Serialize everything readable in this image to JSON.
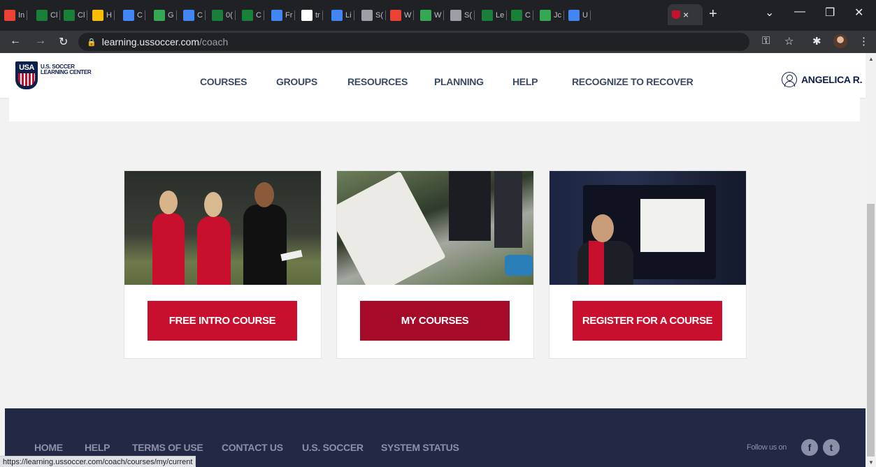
{
  "browser": {
    "tabs": [
      {
        "label": "In",
        "color": "#ea4335"
      },
      {
        "label": "Cl",
        "color": "#188038"
      },
      {
        "label": "Cl",
        "color": "#188038"
      },
      {
        "label": "H",
        "color": "#fbbc04"
      },
      {
        "label": "C",
        "color": "#4285f4"
      },
      {
        "label": "G",
        "color": "#34a853"
      },
      {
        "label": "C",
        "color": "#4285f4"
      },
      {
        "label": "0(",
        "color": "#188038"
      },
      {
        "label": "C",
        "color": "#188038"
      },
      {
        "label": "Fr",
        "color": "#4285f4"
      },
      {
        "label": "tr",
        "color": "#ffffff"
      },
      {
        "label": "Li",
        "color": "#4285f4"
      },
      {
        "label": "S(",
        "color": "#9aa0a6"
      },
      {
        "label": "W",
        "color": "#ea4335"
      },
      {
        "label": "W",
        "color": "#34a853"
      },
      {
        "label": "S(",
        "color": "#9aa0a6"
      },
      {
        "label": "Le",
        "color": "#188038"
      },
      {
        "label": "C",
        "color": "#188038"
      },
      {
        "label": "Jc",
        "color": "#34a853"
      },
      {
        "label": "U",
        "color": "#4285f4"
      }
    ],
    "active_tab_close": "×",
    "new_tab": "+",
    "url_host": "learning.ussoccer.com",
    "url_path": "/coach",
    "status_url": "https://learning.ussoccer.com/coach/courses/my/current"
  },
  "site": {
    "logo_crest": "USA",
    "logo_line1": "U.S. SOCCER",
    "logo_line2": "LEARNING CENTER",
    "nav": [
      "COURSES",
      "GROUPS",
      "RESOURCES",
      "PLANNING",
      "HELP",
      "RECOGNIZE TO RECOVER"
    ],
    "user_name": "ANGELICA R."
  },
  "cards": [
    {
      "button": "FREE INTRO COURSE"
    },
    {
      "button": "MY COURSES"
    },
    {
      "button": "REGISTER FOR A COURSE"
    }
  ],
  "footer": {
    "links": [
      "HOME",
      "HELP",
      "TERMS OF USE",
      "CONTACT US",
      "U.S. SOCCER",
      "SYSTEM STATUS"
    ],
    "follow": "Follow us on",
    "facebook": "f",
    "twitter": "t"
  },
  "colors": {
    "brand_red": "#c8102e",
    "navy": "#0b1f4a",
    "footer_bg": "#232845"
  }
}
